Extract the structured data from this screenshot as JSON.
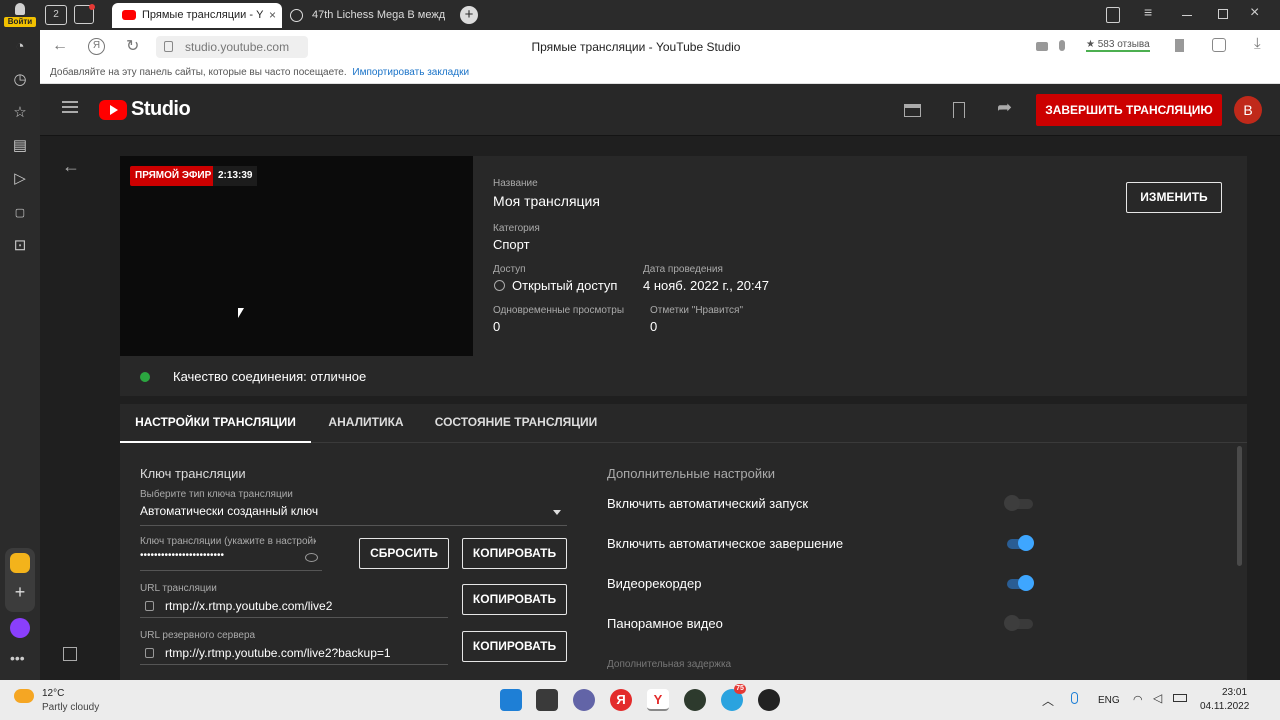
{
  "browser": {
    "signin_label": "Войти",
    "tab_count": "2",
    "tabs": [
      {
        "title": "Прямые трансляции - YouTube Studio",
        "display": "Прямые трансляции - Y"
      },
      {
        "title": "47th Lichess Mega B межд",
        "display": "47th Lichess Mega B межд"
      }
    ],
    "url": "studio.youtube.com",
    "page_title": "Прямые трансляции - YouTube Studio",
    "reviews": "★ 583 отзыва",
    "bookmarks_hint": "Добавляйте на эту панель сайты, которые вы часто посещаете.",
    "bookmarks_import": "Импортировать закладки"
  },
  "studio": {
    "logo_text": "Studio",
    "end_stream_label": "ЗАВЕРШИТЬ ТРАНСЛЯЦИЮ",
    "avatar_letter": "B",
    "live_badge": "ПРЯМОЙ ЭФИР",
    "live_timer": "2:13:39",
    "edit_label": "ИЗМЕНИТЬ",
    "info": {
      "title_label": "Название",
      "title_value": "Моя трансляция",
      "category_label": "Категория",
      "category_value": "Спорт",
      "access_label": "Доступ",
      "access_value": "Открытый доступ",
      "date_label": "Дата проведения",
      "date_value": "4 нояб. 2022 г., 20:47",
      "viewers_label": "Одновременные просмотры",
      "viewers_value": "0",
      "likes_label": "Отметки \"Нравится\"",
      "likes_value": "0"
    },
    "connection_quality": "Качество соединения: отличное",
    "status_color": "#2ba640",
    "tabs": [
      {
        "label": "НАСТРОЙКИ ТРАНСЛЯЦИИ",
        "active": true
      },
      {
        "label": "АНАЛИТИКА",
        "active": false
      },
      {
        "label": "СОСТОЯНИЕ ТРАНСЛЯЦИИ",
        "active": false
      }
    ],
    "stream_key": {
      "heading": "Ключ трансляции",
      "type_label": "Выберите тип ключа трансляции",
      "type_value": "Автоматически созданный ключ",
      "key_label": "Ключ трансляции (укажите в настройках...",
      "key_value": "••••••••••••••••••••••••",
      "reset_label": "СБРОСИТЬ",
      "copy_label": "КОПИРОВАТЬ",
      "url_label": "URL трансляции",
      "url_value": "rtmp://x.rtmp.youtube.com/live2",
      "backup_label": "URL резервного сервера",
      "backup_value": "rtmp://y.rtmp.youtube.com/live2?backup=1"
    },
    "advanced": {
      "heading": "Дополнительные настройки",
      "options": [
        {
          "label": "Включить автоматический запуск",
          "enabled": false
        },
        {
          "label": "Включить автоматическое завершение",
          "enabled": true
        },
        {
          "label": "Видеорекордер",
          "enabled": true
        },
        {
          "label": "Панорамное видео",
          "enabled": false
        }
      ],
      "extra_delay": "Дополнительная задержка"
    },
    "accent_red": "#cc0000",
    "accent_blue": "#3ea6ff"
  },
  "taskbar": {
    "temperature": "12°C",
    "weather": "Partly cloudy",
    "language": "ENG",
    "time": "23:01",
    "date": "04.11.2022",
    "telegram_badge": "75"
  }
}
